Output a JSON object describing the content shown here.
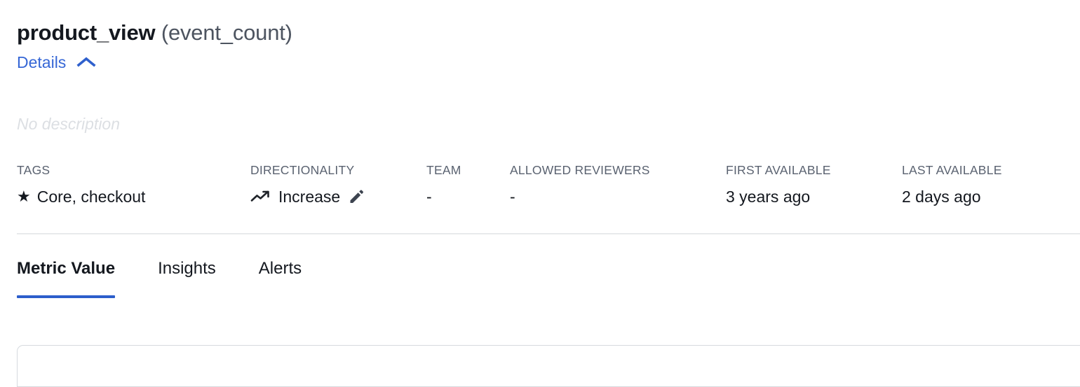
{
  "header": {
    "metric_name": "product_view",
    "metric_type": "(event_count)",
    "details_label": "Details",
    "details_chevron_icon": "chevron-up-icon"
  },
  "description": {
    "text": "No description"
  },
  "meta": {
    "fields": [
      {
        "label": "TAGS",
        "value": "Core, checkout",
        "icon": "star-icon"
      },
      {
        "label": "DIRECTIONALITY",
        "value": "Increase",
        "icon": "trending-up-icon",
        "edit_icon": "pencil-icon"
      },
      {
        "label": "TEAM",
        "value": "-"
      },
      {
        "label": "ALLOWED REVIEWERS",
        "value": "-"
      },
      {
        "label": "FIRST AVAILABLE",
        "value": "3 years ago"
      },
      {
        "label": "LAST AVAILABLE",
        "value": "2 days ago"
      }
    ]
  },
  "tabs": [
    {
      "label": "Metric Value",
      "active": true
    },
    {
      "label": "Insights",
      "active": false
    },
    {
      "label": "Alerts",
      "active": false
    }
  ],
  "colors": {
    "accent_blue": "#2c5ecb",
    "link_blue": "#3667d6",
    "text_primary": "#14181f",
    "text_secondary": "#4d5460",
    "label_gray": "#5a6270",
    "placeholder_gray": "#dcdfe3",
    "divider": "#e8eaec",
    "card_border": "#d6dade",
    "background": "#ffffff"
  }
}
